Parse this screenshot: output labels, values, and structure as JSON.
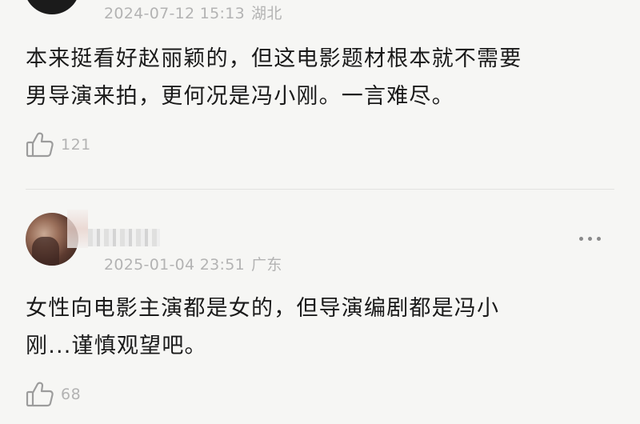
{
  "comments": [
    {
      "date": "2024-07-12 15:13",
      "location": "湖北",
      "lines": [
        "本来挺看好赵丽颖的，但这电影题材根本就不需要",
        "男导演来拍，更何况是冯小刚。一言难尽。"
      ],
      "likes": "121"
    },
    {
      "date": "2025-01-04 23:51",
      "location": "广东",
      "lines": [
        "女性向电影主演都是女的，但导演编剧都是冯小",
        "刚...谨慎观望吧。"
      ],
      "likes": "68"
    }
  ],
  "icons": {
    "like": "thumbs-up-icon",
    "more": "more-options-icon"
  }
}
